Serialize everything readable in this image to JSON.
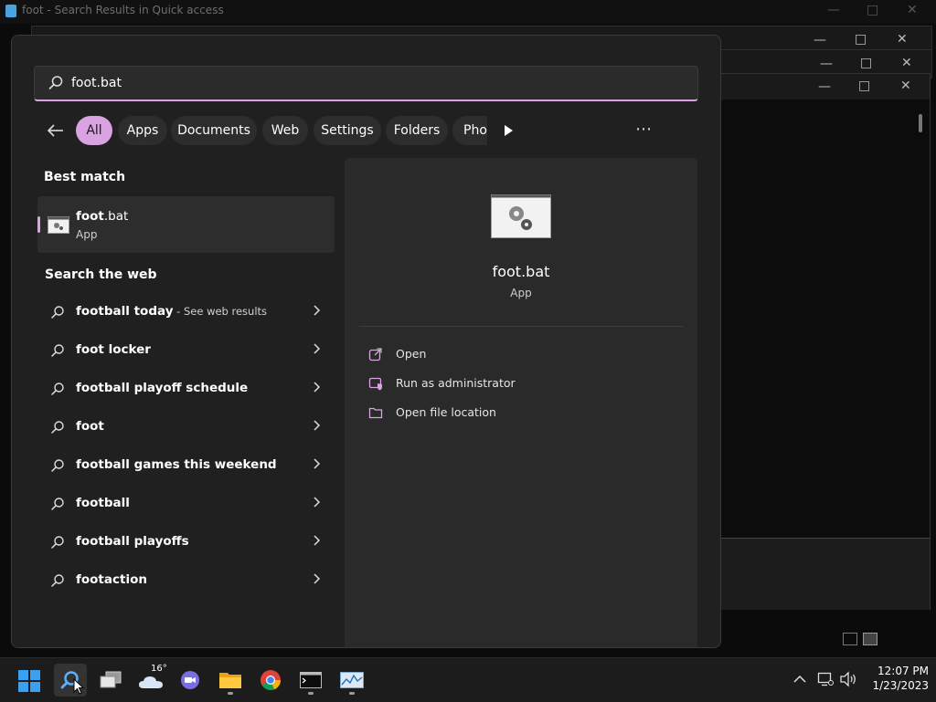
{
  "background": {
    "window_title": "foot - Search Results in Quick access"
  },
  "search": {
    "query": "foot.bat"
  },
  "filters": [
    {
      "label": "All",
      "active": true
    },
    {
      "label": "Apps"
    },
    {
      "label": "Documents"
    },
    {
      "label": "Web"
    },
    {
      "label": "Settings"
    },
    {
      "label": "Folders"
    },
    {
      "label": "Photos"
    }
  ],
  "best_match": {
    "heading": "Best match",
    "name_bold": "foot",
    "name_rest": ".bat",
    "type": "App"
  },
  "web": {
    "heading": "Search the web",
    "items": [
      {
        "bold": "football today",
        "rest": " - See web results"
      },
      {
        "bold": "foot locker",
        "rest": ""
      },
      {
        "bold": "football playoff schedule",
        "rest": ""
      },
      {
        "bold": "foot",
        "rest": ""
      },
      {
        "bold": "football games this weekend",
        "rest": ""
      },
      {
        "bold": "football",
        "rest": ""
      },
      {
        "bold": "football playoffs",
        "rest": ""
      },
      {
        "bold": "footaction",
        "rest": ""
      }
    ]
  },
  "detail": {
    "name": "foot.bat",
    "type": "App",
    "actions": [
      "Open",
      "Run as administrator",
      "Open file location"
    ]
  },
  "taskbar": {
    "weather_temp": "16°",
    "time": "12:07 PM",
    "date": "1/23/2023"
  },
  "colors": {
    "accent": "#d9a3e2",
    "panel": "#202020",
    "detail": "#2a2a2a"
  }
}
